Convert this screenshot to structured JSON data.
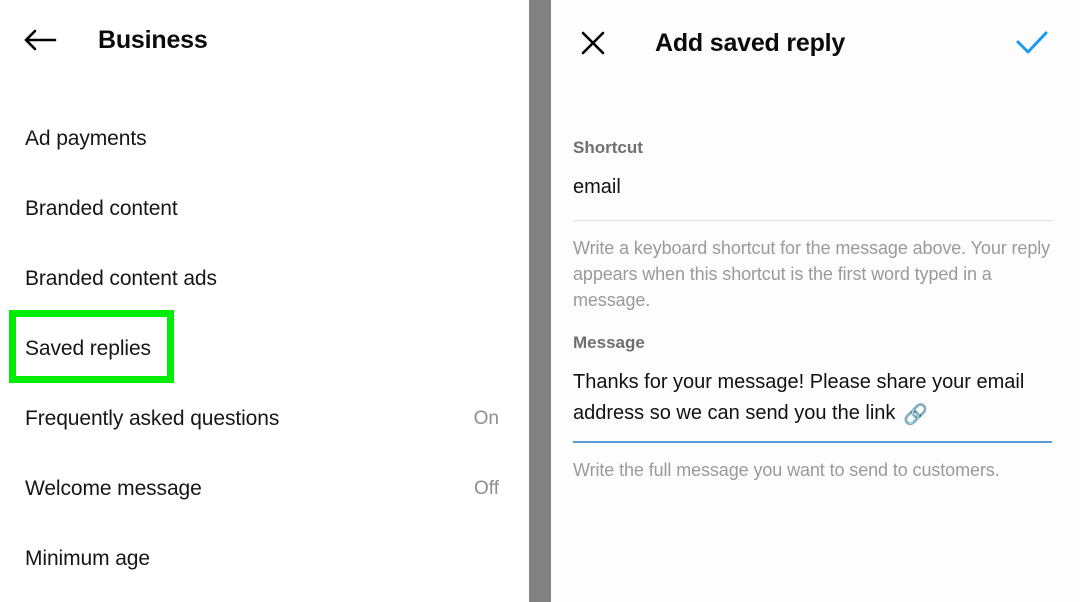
{
  "left_panel": {
    "header": {
      "back_icon": "back-arrow-icon",
      "title": "Business"
    },
    "menu_items": [
      {
        "label": "Ad payments",
        "value": ""
      },
      {
        "label": "Branded content",
        "value": ""
      },
      {
        "label": "Branded content ads",
        "value": ""
      },
      {
        "label": "Saved replies",
        "value": "",
        "highlighted": true
      },
      {
        "label": "Frequently asked questions",
        "value": "On"
      },
      {
        "label": "Welcome message",
        "value": "Off"
      },
      {
        "label": "Minimum age",
        "value": ""
      }
    ],
    "highlight_color": "#00ed00"
  },
  "divider": {
    "color": "#828282"
  },
  "right_panel": {
    "header": {
      "close_icon": "close-x-icon",
      "title": "Add saved reply",
      "confirm_icon": "checkmark-icon",
      "confirm_color": "#1d9bf0"
    },
    "shortcut_field": {
      "label": "Shortcut",
      "value": "email",
      "placeholder": "Shortcut",
      "help": "Write a keyboard shortcut for the message above. Your reply appears when this shortcut is the first word typed in a message."
    },
    "message_field": {
      "label": "Message",
      "value": "Thanks for your message! Please share your email address so we can send you the link ",
      "emoji": "🔗",
      "placeholder": "Message",
      "help": "Write the full message you want to send to customers.",
      "underline_color": "#5b9bd5"
    }
  }
}
